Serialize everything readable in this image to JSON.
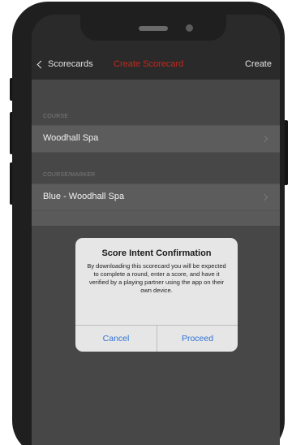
{
  "navigation": {
    "back_label": "Scorecards",
    "title": "Create Scorecard",
    "action_label": "Create",
    "accent_color": "#c7271c"
  },
  "form": {
    "course_header": "COURSE",
    "course_value": "Woodhall Spa",
    "marker_header": "COURSE/MARKER",
    "marker_value": "Blue - Woodhall Spa"
  },
  "alert": {
    "title": "Score Intent Confirmation",
    "message": "By downloading this scorecard you will be expected to complete a round, enter a score, and have it verified by a playing partner using the app on their own device.",
    "cancel_label": "Cancel",
    "proceed_label": "Proceed",
    "button_color": "#2f73d6"
  },
  "icons": {
    "back": "chevron-left-icon",
    "disclosure": "chevron-right-icon"
  }
}
